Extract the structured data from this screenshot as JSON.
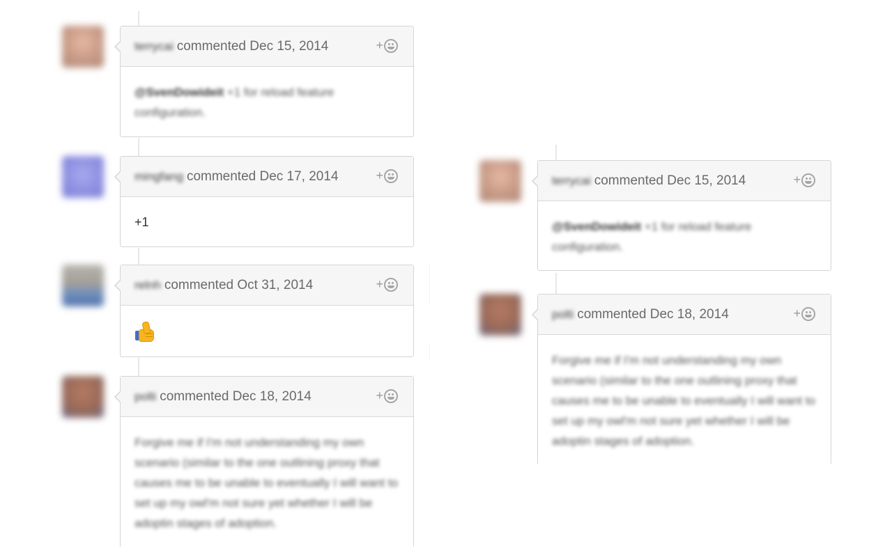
{
  "left_column": {
    "comments": [
      {
        "author": "terrycai",
        "action": "commented Dec 15, 2014",
        "mention": "@SvenDowideit",
        "body": "+1 for reload feature configuration.",
        "reaction_plus": "+"
      },
      {
        "author": "mingfang",
        "action": "commented Dec 17, 2014",
        "body": "+1",
        "reaction_plus": "+"
      },
      {
        "author": "relnh",
        "action": "commented Oct 31, 2014",
        "reaction_plus": "+"
      },
      {
        "author": "polti",
        "action": "commented Dec 18, 2014",
        "body": "Forgive me if I'm not understanding my own scenario (similar to the one outlining proxy that causes me to be unable to eventually I will want to set up my owl'm not sure yet whether I will be adoptin stages of adoption.",
        "reaction_plus": "+"
      }
    ]
  },
  "right_column": {
    "comments": [
      {
        "author": "terrycai",
        "action": "commented Dec 15, 2014",
        "mention": "@SvenDowideit",
        "body": "+1 for reload feature configuration.",
        "reaction_plus": "+"
      },
      {
        "author": "polti",
        "action": "commented Dec 18, 2014",
        "body": "Forgive me if I'm not understanding my own scenario (similar to the one outlining proxy that causes me to be unable to eventually I will want to set up my owl'm not sure yet whether I will be adoptin stages of adoption.",
        "reaction_plus": "+"
      }
    ]
  },
  "colors": {
    "avatar_terrycai": "#c79a86",
    "avatar_mingfang": "#8c8ee0",
    "avatar_relnh": "#6f8fbf",
    "avatar_polti": "#9a6a58",
    "header_bg": "#f6f6f6",
    "border": "#d1d5da"
  },
  "icons": {
    "reaction": "smiley-icon",
    "thumbs_up": "thumbs-up-icon"
  }
}
